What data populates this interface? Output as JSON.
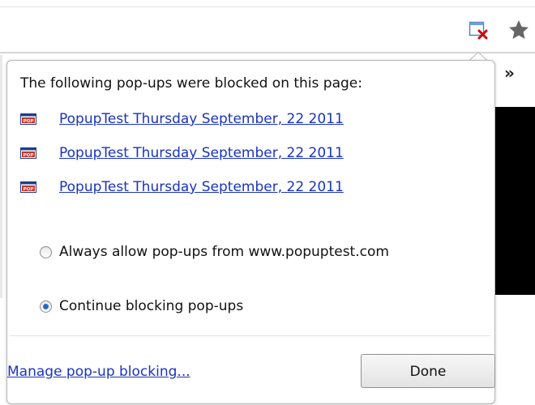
{
  "toolbar": {
    "blocked_icon": "popup-blocked-icon",
    "star_icon": "bookmark-star-icon",
    "chevron": "»"
  },
  "bubble": {
    "title": "The following pop-ups were blocked on this page:",
    "popups": [
      {
        "icon": "pop-window-icon",
        "label": "PopupTest Thursday September, 22 2011"
      },
      {
        "icon": "pop-window-icon",
        "label": "PopupTest Thursday September, 22 2011"
      },
      {
        "icon": "pop-window-icon",
        "label": "PopupTest Thursday September, 22 2011"
      }
    ],
    "options": [
      {
        "label": "Always allow pop-ups from www.popuptest.com",
        "checked": false
      },
      {
        "label": "Continue blocking pop-ups",
        "checked": true
      }
    ],
    "manage_link": "Manage pop-up blocking...",
    "done_label": "Done"
  },
  "colors": {
    "link": "#1a33bd",
    "radio_selected": "#2a63b8",
    "blocked_x": "#d40000"
  }
}
